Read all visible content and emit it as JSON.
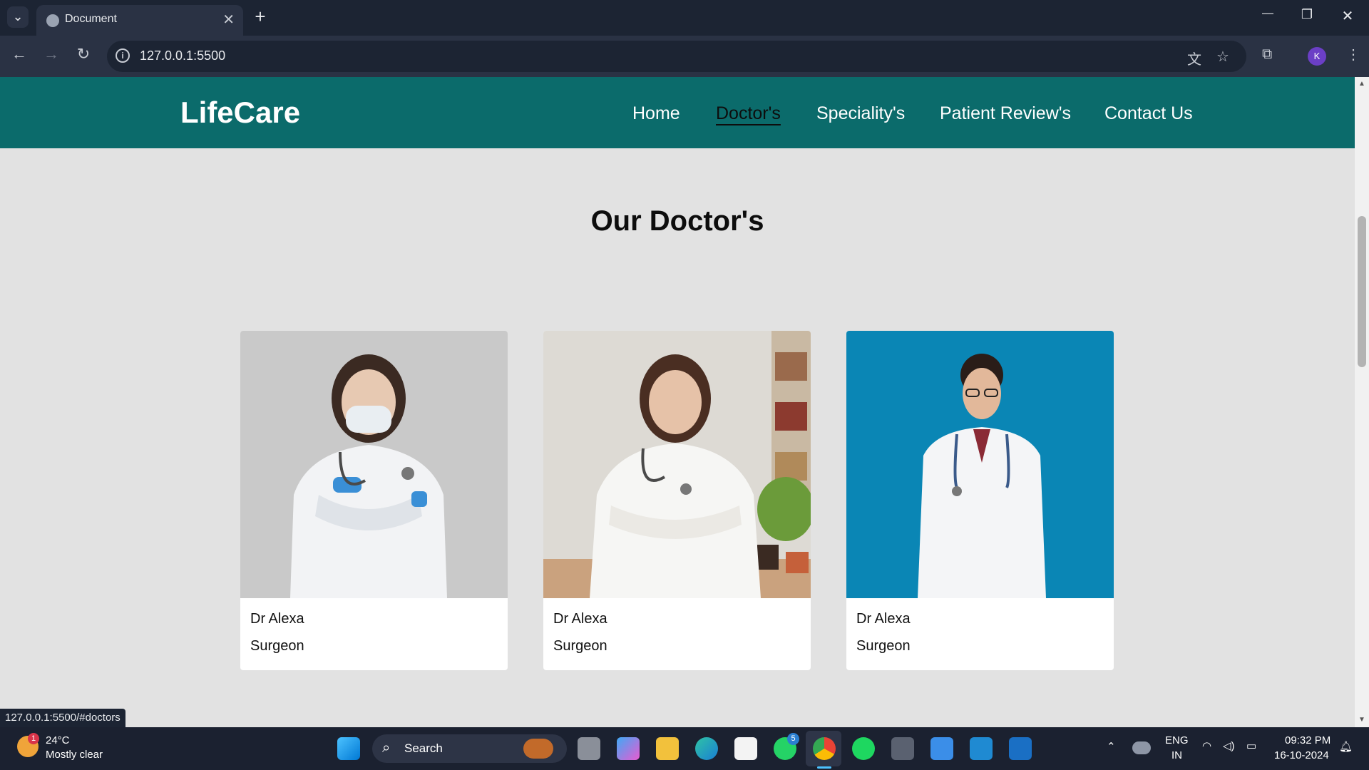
{
  "browser": {
    "tab_title": "Document",
    "tab_close": "✕",
    "new_tab": "+",
    "tab_menu": "⌄",
    "url": "127.0.0.1:5500",
    "avatar_letter": "K",
    "window_controls": {
      "minimize": "—",
      "restore": "❐",
      "close": "✕"
    }
  },
  "site": {
    "logo": "LifeCare",
    "menu": [
      "Home",
      "Doctor's",
      "Speciality's",
      "Patient Review's",
      "Contact Us"
    ],
    "active_menu": "Doctor's",
    "heading": "Our Doctor's",
    "doctors": [
      {
        "name": "Dr Alexa",
        "role": "Surgeon",
        "photo_bg": "#c8c8c8"
      },
      {
        "name": "Dr Alexa",
        "role": "Surgeon",
        "photo_bg": "#dfdcd6"
      },
      {
        "name": "Dr Alexa",
        "role": "Surgeon",
        "photo_bg": "#0b86b5"
      }
    ]
  },
  "status_link": "127.0.0.1:5500/#doctors",
  "taskbar": {
    "weather_temp": "24°C",
    "weather_desc": "Mostly clear",
    "weather_badge": "1",
    "search_label": "Search",
    "whatsapp_badge": "5",
    "lang_line1": "ENG",
    "lang_line2": "IN",
    "time": "09:32 PM",
    "date": "16-10-2024"
  },
  "colors": {
    "nav_teal": "#0b6b6b",
    "page_bg": "#e2e2e2",
    "browser_dark": "#1c2433"
  }
}
